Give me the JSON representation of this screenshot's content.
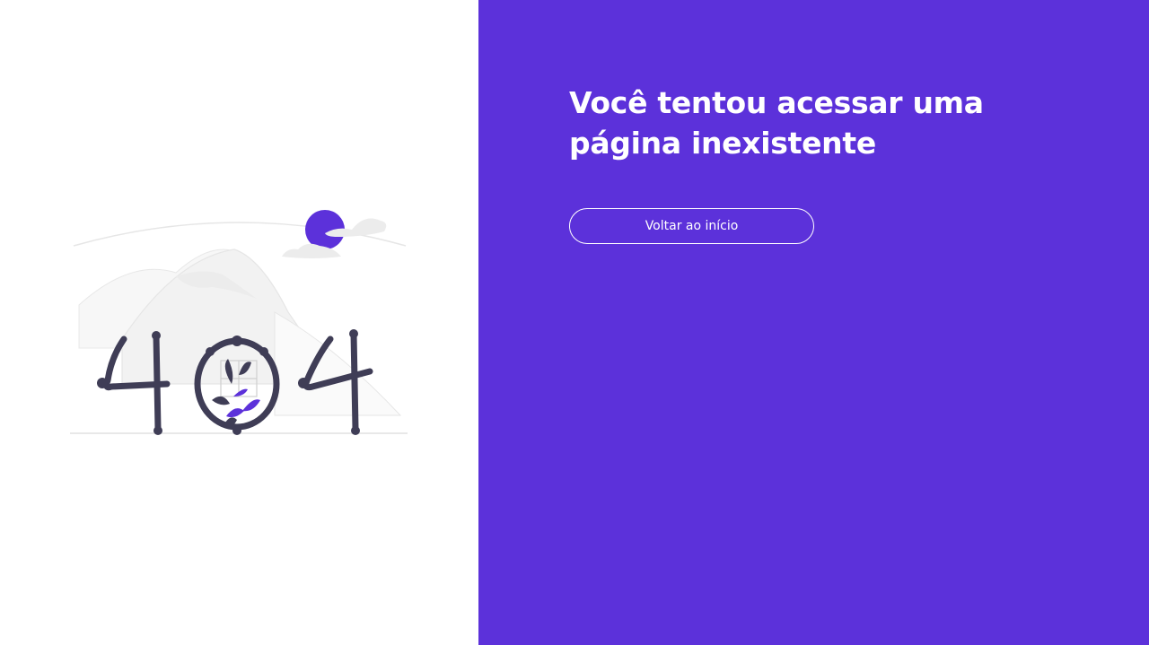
{
  "colors": {
    "accent": "#5c31da",
    "illustration_dark": "#3f3d56",
    "illustration_light": "#f2f2f2",
    "illustration_line": "#e6e6e6",
    "text_on_accent": "#ffffff"
  },
  "illustration": {
    "digits": [
      "4",
      "0",
      "4"
    ]
  },
  "main": {
    "headline": "Você tentou acessar uma página inexistente",
    "home_button_label": "Voltar ao início"
  }
}
